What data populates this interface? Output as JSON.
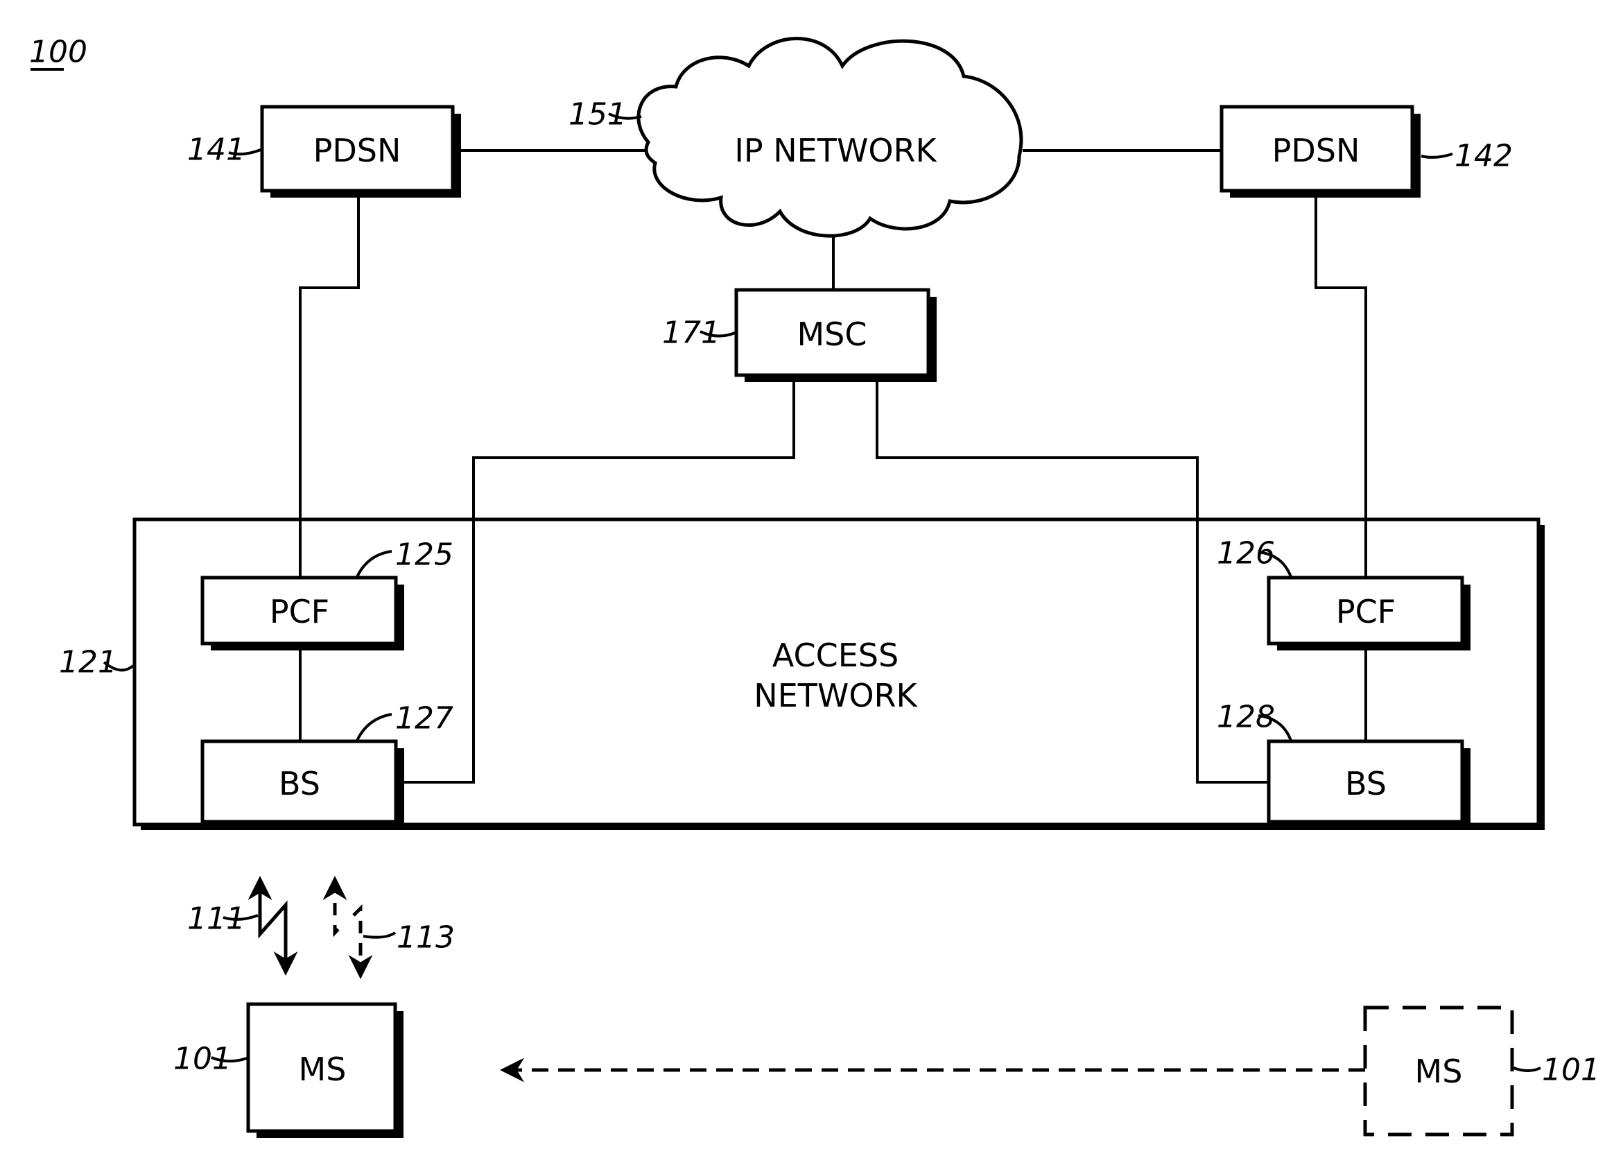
{
  "figure": {
    "reference": "100",
    "nodes": {
      "pdsn_left": {
        "label": "PDSN",
        "ref": "141"
      },
      "pdsn_right": {
        "label": "PDSN",
        "ref": "142"
      },
      "ip_network": {
        "label": "IP NETWORK",
        "ref": "151"
      },
      "msc": {
        "label": "MSC",
        "ref": "171"
      },
      "access_network": {
        "label_line1": "ACCESS",
        "label_line2": "NETWORK",
        "ref": "121"
      },
      "pcf_left": {
        "label": "PCF",
        "ref": "125"
      },
      "pcf_right": {
        "label": "PCF",
        "ref": "126"
      },
      "bs_left": {
        "label": "BS",
        "ref": "127"
      },
      "bs_right": {
        "label": "BS",
        "ref": "128"
      },
      "ms": {
        "label": "MS",
        "ref": "101"
      },
      "ms_moving": {
        "label": "MS",
        "ref": "101"
      }
    },
    "links": {
      "wireless_solid": {
        "ref": "111"
      },
      "wireless_dashed": {
        "ref": "113"
      }
    }
  }
}
